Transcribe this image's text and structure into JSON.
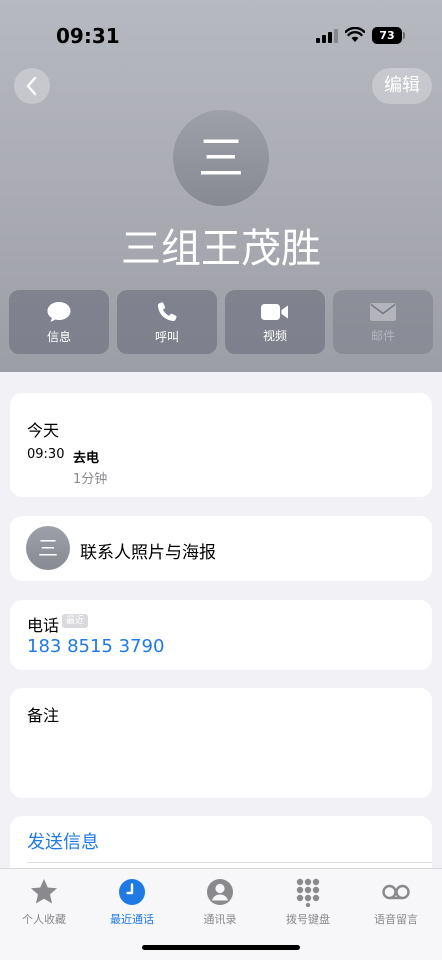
{
  "status_bar": {
    "time": "09:31",
    "battery": "73"
  },
  "header": {
    "edit_label": "编辑",
    "avatar_initial": "三",
    "contact_name": "三组王茂胜"
  },
  "actions": [
    {
      "label": "信息",
      "icon": "message-icon",
      "enabled": true
    },
    {
      "label": "呼叫",
      "icon": "phone-icon",
      "enabled": true
    },
    {
      "label": "视频",
      "icon": "video-icon",
      "enabled": true
    },
    {
      "label": "邮件",
      "icon": "mail-icon",
      "enabled": false
    }
  ],
  "recent": {
    "title": "今天",
    "time": "09:30",
    "type": "去电",
    "duration": "1分钟"
  },
  "poster": {
    "avatar_initial": "三",
    "label": "联系人照片与海报"
  },
  "phone": {
    "label": "电话",
    "tag": "最近",
    "number": "183 8515 3790"
  },
  "notes": {
    "label": "备注"
  },
  "send": {
    "label": "发送信息"
  },
  "tabs": [
    {
      "label": "个人收藏",
      "icon": "star-icon",
      "active": false
    },
    {
      "label": "最近通话",
      "icon": "clock-icon",
      "active": true
    },
    {
      "label": "通讯录",
      "icon": "person-icon",
      "active": false
    },
    {
      "label": "拨号键盘",
      "icon": "keypad-icon",
      "active": false
    },
    {
      "label": "语音留言",
      "icon": "voicemail-icon",
      "active": false
    }
  ],
  "colors": {
    "accent": "#1f7ae6",
    "tab_inactive": "#8a8a8e"
  }
}
